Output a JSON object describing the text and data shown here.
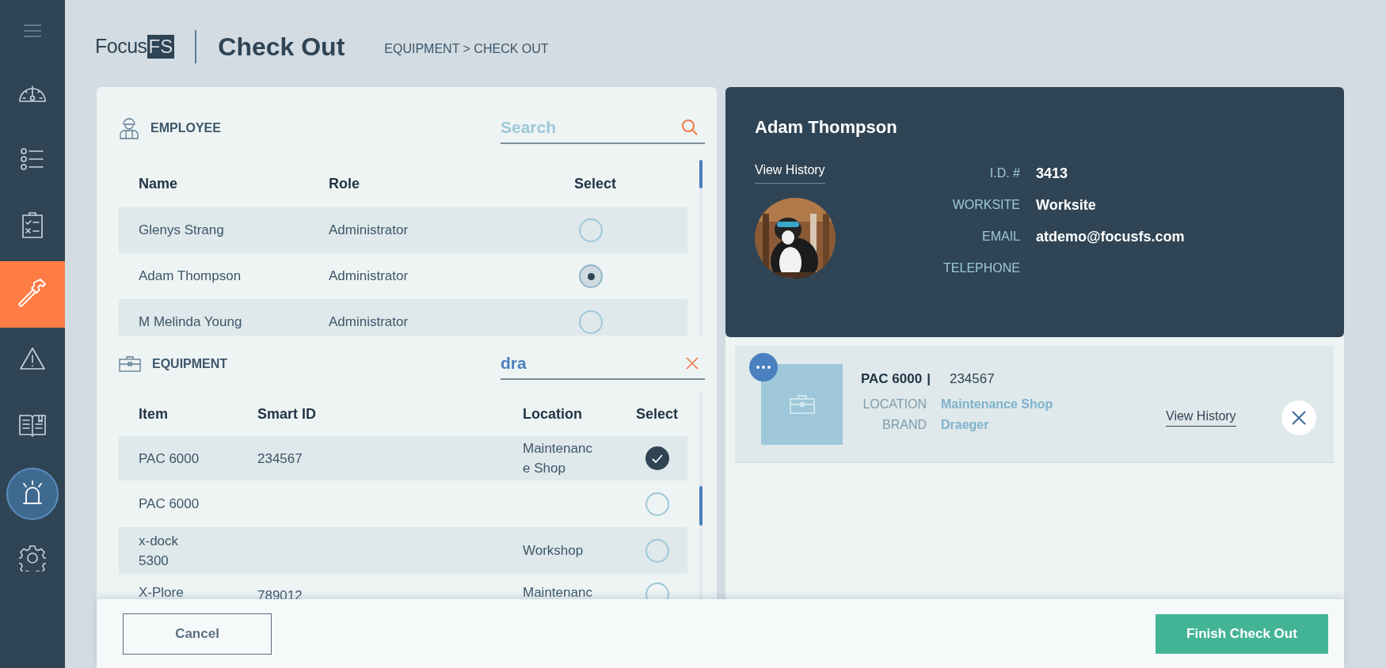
{
  "sidebar": {
    "items": [
      {
        "selected": false,
        "highlighted": false
      },
      {
        "selected": false,
        "highlighted": false
      },
      {
        "selected": false,
        "highlighted": false
      },
      {
        "selected": true,
        "highlighted": false
      },
      {
        "selected": false,
        "highlighted": false
      },
      {
        "selected": false,
        "highlighted": false
      },
      {
        "selected": false,
        "highlighted": true
      },
      {
        "selected": false,
        "highlighted": false
      }
    ]
  },
  "header": {
    "logo": {
      "text": "Focus",
      "badge": "FS"
    },
    "title": "Check Out",
    "breadcrumb": "EQUIPMENT > CHECK OUT"
  },
  "employee": {
    "heading": "EMPLOYEE",
    "search": {
      "placeholder": "Search"
    },
    "columns": [
      "Name",
      "Role",
      "Select"
    ],
    "rows": [
      {
        "name": "Glenys Strang",
        "role": "Administrator",
        "selected": false
      },
      {
        "name": "Adam Thompson",
        "role": "Administrator",
        "selected": true
      },
      {
        "name": "M Melinda Young",
        "role": "Administrator",
        "selected": false
      }
    ]
  },
  "equipment": {
    "heading": "EQUIPMENT",
    "search": {
      "value": "dra"
    },
    "columns": [
      "Item",
      "Smart ID",
      "Location",
      "Select"
    ],
    "rows": [
      {
        "item": "PAC 6000",
        "smart_id": "234567",
        "location": "Maintenance Shop",
        "selected": true
      },
      {
        "item": "PAC 6000",
        "selected": false
      },
      {
        "item": "x-dock 5300",
        "location": "Workshop",
        "selected": false
      },
      {
        "item": "X-Plore",
        "smart_id": "789012",
        "location": "Maintenanc",
        "selected": false
      }
    ]
  },
  "employee_card": {
    "name": "Adam Thompson",
    "history_link": "View History",
    "fields": [
      {
        "label": "I.D. #",
        "value": "3413"
      },
      {
        "label": "WORKSITE",
        "value": "Worksite"
      },
      {
        "label": "EMAIL",
        "value": "atdemo@focusfs.com"
      },
      {
        "label": "TELEPHONE"
      }
    ]
  },
  "checked_out": [
    {
      "name": "PAC 6000",
      "separator": "|",
      "smart_id": "234567",
      "history_link": "View History",
      "fields": [
        {
          "label": "LOCATION",
          "value": "Maintenance Shop"
        },
        {
          "label": "BRAND",
          "value": "Draeger"
        }
      ]
    }
  ],
  "footer": {
    "cancel": "Cancel",
    "finish": "Finish Check Out"
  }
}
